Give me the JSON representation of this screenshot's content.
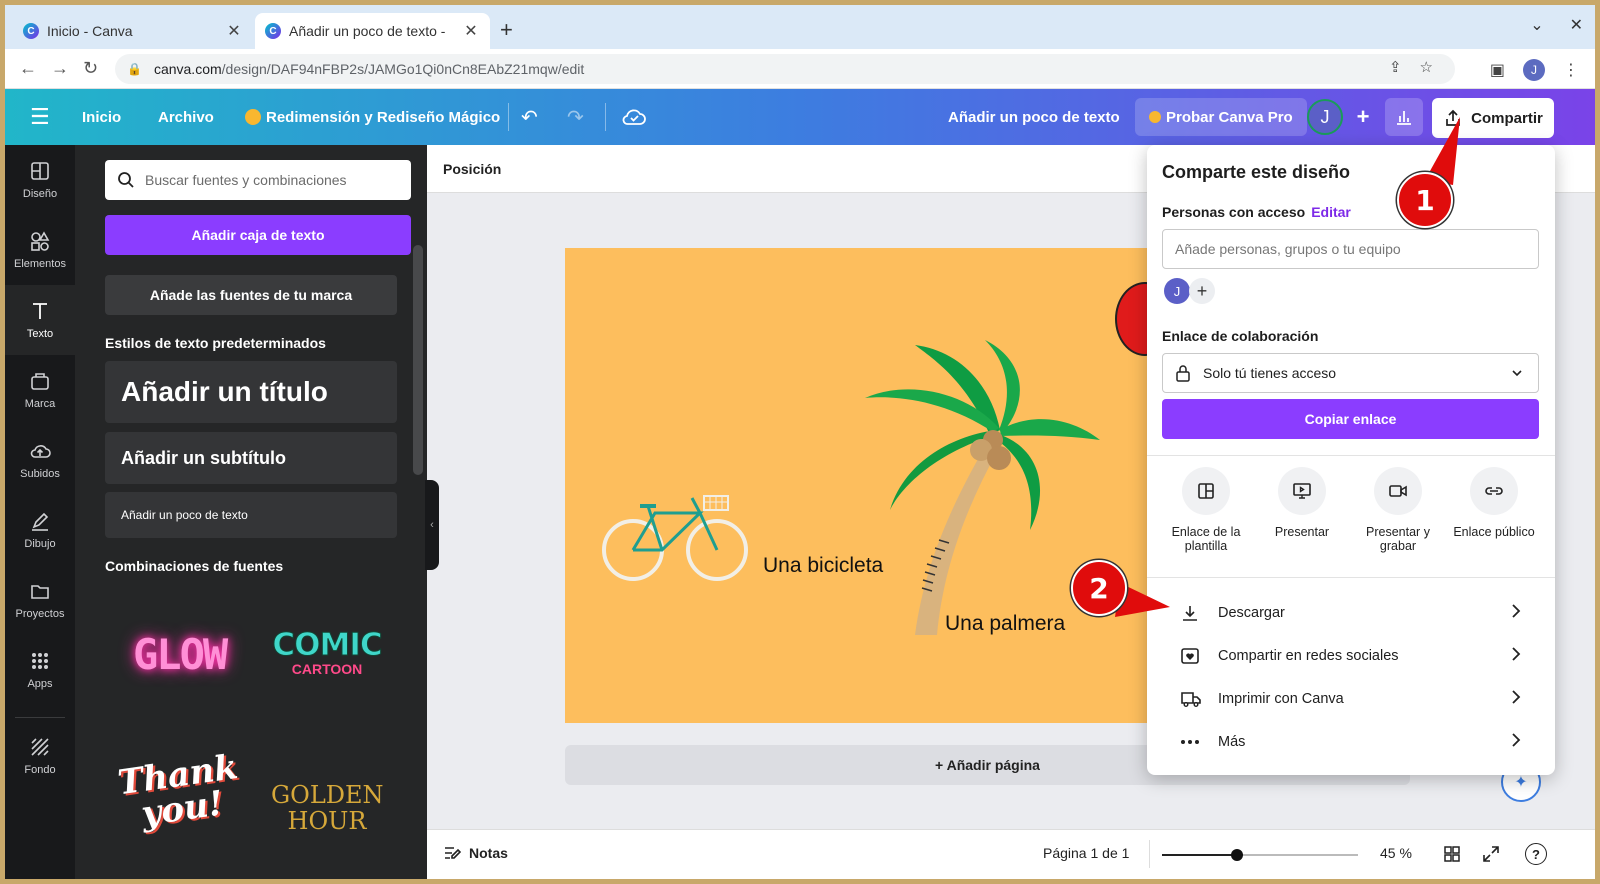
{
  "browser": {
    "tabs": [
      {
        "title": "Inicio - Canva"
      },
      {
        "title": "Añadir un poco de texto -"
      }
    ],
    "url_host": "canva.com",
    "url_path": "/design/DAF94nFBP2s/JAMGo1Qi0nCn8EAbZ21mqw/edit",
    "profile_initial": "J"
  },
  "header": {
    "home": "Inicio",
    "file": "Archivo",
    "magic": "Redimensión y Rediseño Mágico",
    "doc_title": "Añadir un poco de texto",
    "pro": "Probar Canva Pro",
    "avatar": "J",
    "share": "Compartir"
  },
  "rail": {
    "items": [
      {
        "label": "Diseño",
        "icon": "layout-icon"
      },
      {
        "label": "Elementos",
        "icon": "shapes-icon"
      },
      {
        "label": "Texto",
        "icon": "text-icon"
      },
      {
        "label": "Marca",
        "icon": "brand-icon"
      },
      {
        "label": "Subidos",
        "icon": "upload-cloud-icon"
      },
      {
        "label": "Dibujo",
        "icon": "pen-icon"
      },
      {
        "label": "Proyectos",
        "icon": "folder-icon"
      },
      {
        "label": "Apps",
        "icon": "apps-grid-icon"
      },
      {
        "label": "Fondo",
        "icon": "background-icon"
      }
    ]
  },
  "panel": {
    "search_placeholder": "Buscar fuentes y combinaciones",
    "add_textbox": "Añadir caja de texto",
    "brand_fonts": "Añade las fuentes de tu marca",
    "default_styles": "Estilos de texto predeterminados",
    "title": "Añadir un título",
    "subtitle": "Añadir un subtítulo",
    "body": "Añadir un poco de texto",
    "combos": "Combinaciones de fuentes",
    "font_cards": [
      "GLOW",
      "COMIC",
      "CARTOON",
      "Thank",
      "you!",
      "GOLDEN",
      "HOUR"
    ]
  },
  "canvas": {
    "toolbar": "Posición",
    "caption_bike": "Una bicicleta",
    "caption_palm": "Una palmera",
    "add_page": "+ Añadir página",
    "notes": "Notas",
    "page_info": "Página 1 de 1",
    "zoom": "45 %",
    "zoom_level": 0.45
  },
  "share_popup": {
    "title": "Comparte este diseño",
    "people_label": "Personas con acceso",
    "edit": "Editar",
    "people_placeholder": "Añade personas, grupos o tu equipo",
    "avatar": "J",
    "collab_label": "Enlace de colaboración",
    "access": "Solo tú tienes acceso",
    "copy": "Copiar enlace",
    "options": [
      {
        "label": "Enlace de la plantilla",
        "icon": "template-icon"
      },
      {
        "label": "Presentar",
        "icon": "present-icon"
      },
      {
        "label": "Presentar y grabar",
        "icon": "record-icon"
      },
      {
        "label": "Enlace público",
        "icon": "link-icon"
      }
    ],
    "rows": [
      {
        "label": "Descargar",
        "icon": "download-icon"
      },
      {
        "label": "Compartir en redes sociales",
        "icon": "heart-social-icon"
      },
      {
        "label": "Imprimir con Canva",
        "icon": "truck-icon"
      },
      {
        "label": "Más",
        "icon": "more-dots-icon"
      }
    ]
  },
  "annotations": {
    "badge1": "1",
    "badge2": "2",
    "color": "#e00c0c"
  }
}
